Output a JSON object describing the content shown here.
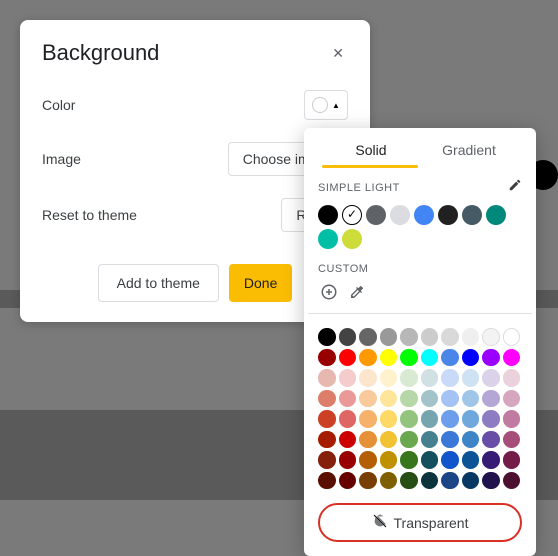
{
  "dialog": {
    "title": "Background",
    "rows": {
      "color": "Color",
      "image": "Image",
      "reset": "Reset to theme"
    },
    "buttons": {
      "choose_image": "Choose image",
      "reset": "Reset",
      "add_to_theme": "Add to theme",
      "done": "Done"
    }
  },
  "picker": {
    "tabs": {
      "solid": "Solid",
      "gradient": "Gradient"
    },
    "sections": {
      "simple_light": "SIMPLE LIGHT",
      "custom": "CUSTOM"
    },
    "transparent": "Transparent",
    "simple_light_colors": [
      "#000000",
      "checked",
      "#5f6368",
      "#dadce0",
      "#4285f4",
      "#212121",
      "#455a64",
      "#00897b",
      "#00bfa5",
      "#cddc39"
    ],
    "grid": [
      [
        "#000000",
        "#434343",
        "#666666",
        "#999999",
        "#b7b7b7",
        "#cccccc",
        "#d9d9d9",
        "#efefef",
        "#f3f3f3",
        "#ffffff"
      ],
      [
        "#980000",
        "#ff0000",
        "#ff9900",
        "#ffff00",
        "#00ff00",
        "#00ffff",
        "#4a86e8",
        "#0000ff",
        "#9900ff",
        "#ff00ff"
      ],
      [
        "#e6b8af",
        "#f4cccc",
        "#fce5cd",
        "#fff2cc",
        "#d9ead3",
        "#d0e0e3",
        "#c9daf8",
        "#cfe2f3",
        "#d9d2e9",
        "#ead1dc"
      ],
      [
        "#dd7e6b",
        "#ea9999",
        "#f9cb9c",
        "#ffe599",
        "#b6d7a8",
        "#a2c4c9",
        "#a4c2f4",
        "#9fc5e8",
        "#b4a7d6",
        "#d5a6bd"
      ],
      [
        "#cc4125",
        "#e06666",
        "#f6b26b",
        "#ffd966",
        "#93c47d",
        "#76a5af",
        "#6d9eeb",
        "#6fa8dc",
        "#8e7cc3",
        "#c27ba0"
      ],
      [
        "#a61c00",
        "#cc0000",
        "#e69138",
        "#f1c232",
        "#6aa84f",
        "#45818e",
        "#3c78d8",
        "#3d85c6",
        "#674ea7",
        "#a64d79"
      ],
      [
        "#85200c",
        "#990000",
        "#b45f06",
        "#bf9000",
        "#38761d",
        "#134f5c",
        "#1155cc",
        "#0b5394",
        "#351c75",
        "#741b47"
      ],
      [
        "#5b0f00",
        "#660000",
        "#783f04",
        "#7f6000",
        "#274e13",
        "#0c343d",
        "#1c4587",
        "#073763",
        "#20124d",
        "#4c1130"
      ]
    ]
  }
}
